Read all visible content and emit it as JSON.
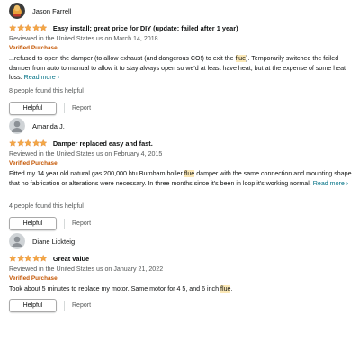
{
  "colors": {
    "star": "#f3a847",
    "verified": "#c45500",
    "link": "#007185",
    "highlight": "#fbe8b6"
  },
  "reviews": [
    {
      "author": "Jason Farrell",
      "avatar": "user-avatar-icon",
      "rating": 5,
      "title": "Easy install; great price for DIY (update: failed after 1 year)",
      "date": "Reviewed in the United States us on March 14, 2018",
      "verified": "Verified Purchase",
      "body_before": "...refused to open the damper (to allow exhaust (and dangerous CO!) to exit the ",
      "highlight": "flue",
      "body_after": "). Temporarily switched the failed damper from auto to manual to allow it to stay always open so we'd at least have heat, but at the expense of some heat loss.",
      "read_more": "Read more",
      "helpful_count": "8 people found this helpful",
      "helpful_label": "Helpful",
      "report_label": "Report"
    },
    {
      "author": "Amanda J.",
      "avatar": "default-avatar-icon",
      "rating": 5,
      "title": "Damper replaced easy and fast.",
      "date": "Reviewed in the United States us on February 4, 2015",
      "verified": "Verified Purchase",
      "body_before": "Fitted my 14 year old natural gas 200,000 btu Burnham boiler ",
      "highlight": "flue",
      "body_after": " damper with the same connection and mounting shape that no fabrication or alterations were necessary. In three months since it's been in loop it's working normal.",
      "read_more": "Read more",
      "helpful_count": "4 people found this helpful",
      "helpful_label": "Helpful",
      "report_label": "Report"
    },
    {
      "author": "Diane Lickteig",
      "avatar": "default-avatar-icon",
      "rating": 5,
      "title": "Great value",
      "date": "Reviewed in the United States us on January 21, 2022",
      "verified": "Verified Purchase",
      "body_before": "Took about 5 minutes to replace my motor. Same motor for 4 5, and 6 inch ",
      "highlight": "flue",
      "body_after": ".",
      "helpful_label": "Helpful",
      "report_label": "Report"
    }
  ]
}
